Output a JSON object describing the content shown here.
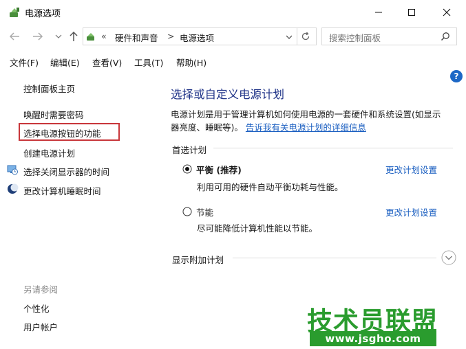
{
  "window": {
    "title": "电源选项",
    "colors": {
      "accent": "#0066cc",
      "heading": "#1e3287",
      "link": "#1b5fc1",
      "highlight_box": "#c8363a",
      "watermark": "#2a9c2e"
    }
  },
  "address_bar": {
    "overflow": "«",
    "breadcrumb": [
      "硬件和声音",
      "电源选项"
    ],
    "separator": ">",
    "search_placeholder": "搜索控制面板"
  },
  "menu": [
    "文件(F)",
    "编辑(E)",
    "查看(V)",
    "工具(T)",
    "帮助(H)"
  ],
  "sidebar": {
    "home": "控制面板主页",
    "items": [
      {
        "label": "唤醒时需要密码",
        "icon": ""
      },
      {
        "label": "选择电源按钮的功能",
        "icon": "",
        "highlighted": true
      },
      {
        "label": "创建电源计划",
        "icon": ""
      },
      {
        "label": "选择关闭显示器的时间",
        "icon": "monitor-clock-icon"
      },
      {
        "label": "更改计算机睡眠时间",
        "icon": "moon-icon"
      }
    ],
    "see_also_title": "另请参阅",
    "see_also": [
      "个性化",
      "用户帐户"
    ]
  },
  "main": {
    "heading": "选择或自定义电源计划",
    "description_line1": "电源计划是用于管理计算机如何使用电源的一套硬件和系统设置(如显示",
    "description_line2_prefix": "器亮度、睡眠等)。",
    "description_link": "告诉我有关电源计划的详细信息",
    "preferred_title": "首选计划",
    "plans": [
      {
        "name": "平衡 (推荐)",
        "desc": "利用可用的硬件自动平衡功耗与性能。",
        "selected": true,
        "change_link": "更改计划设置"
      },
      {
        "name": "节能",
        "desc": "尽可能降低计算机性能以节能。",
        "selected": false,
        "change_link": "更改计划设置"
      }
    ],
    "additional_title": "显示附加计划"
  },
  "watermark": {
    "title": "技术员联盟",
    "url": "www.jsgho.com"
  }
}
